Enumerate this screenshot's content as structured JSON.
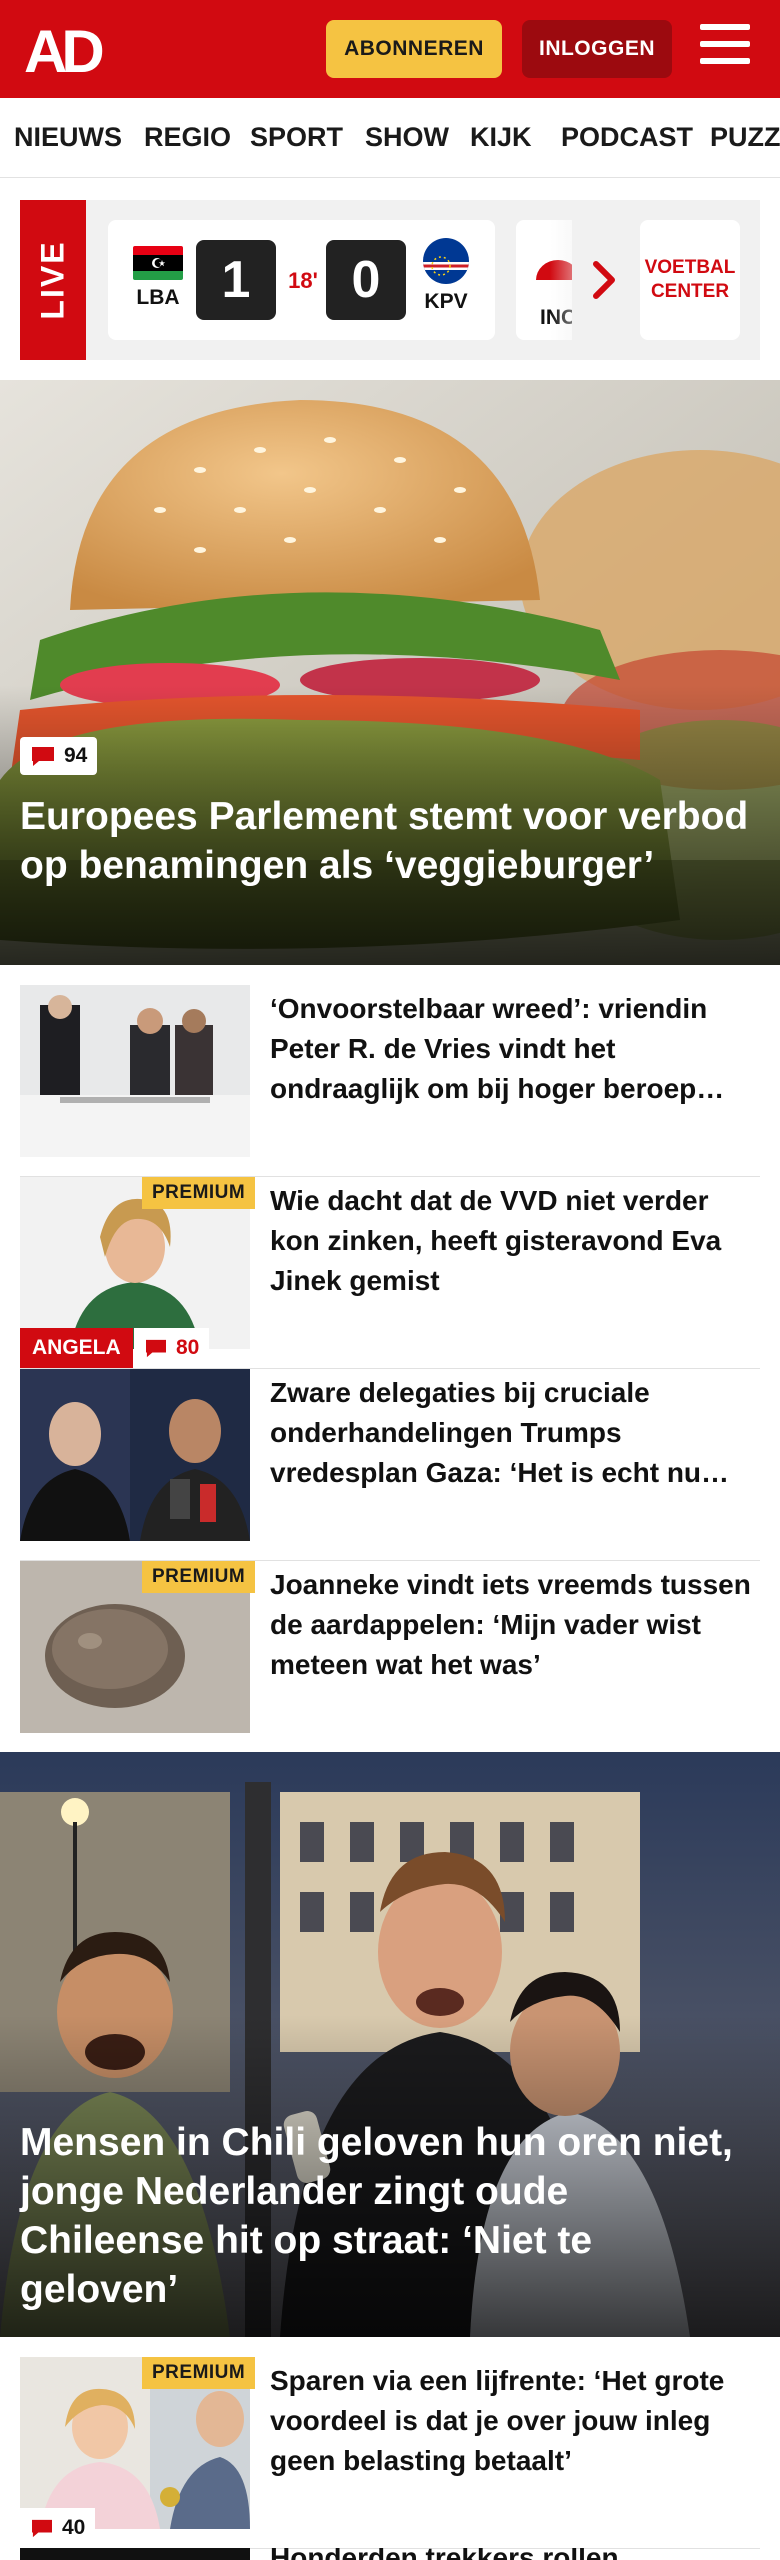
{
  "header": {
    "logo_text": "AD",
    "subscribe_label": "ABONNEREN",
    "login_label": "INLOGGEN",
    "menu_icon": "hamburger-menu-icon",
    "brand_color": "#d10a11",
    "accent_color": "#f5c342"
  },
  "nav": {
    "items": [
      "NIEUWS",
      "REGIO",
      "SPORT",
      "SHOW",
      "KIJK",
      "PODCAST",
      "PUZZ"
    ]
  },
  "live": {
    "label": "LIVE",
    "match": {
      "home_code": "LBA",
      "home_score": "1",
      "minute": "18'",
      "away_score": "0",
      "away_code": "KPV"
    },
    "next_match_code": "INC",
    "chevron_icon": "chevron-right-icon",
    "voetbal_center_label": "VOETBAL CENTER"
  },
  "hero": {
    "comment_count": "94",
    "title": "Europees Parlement stemt voor verbod op benamingen als ‘veggieburger’"
  },
  "articles": [
    {
      "title": "‘Onvoorstelbaar wreed’: vriendin Peter R. de Vries vindt het ondraaglijk om bij hoger beroep…",
      "premium": false
    },
    {
      "title": "Wie dacht dat de VVD niet verder kon zinken, heeft gisteravond Eva Jinek gemist",
      "premium": true,
      "premium_label": "PREMIUM",
      "author_tag": "ANGELA",
      "comment_count": "80"
    },
    {
      "title": "Zware delegaties bij cruciale onderhandelingen Trumps vredesplan Gaza: ‘Het is echt nu…",
      "premium": false
    },
    {
      "title": "Joanneke vindt iets vreemds tussen de aardappelen: ‘Mijn vader wist meteen wat het was’",
      "premium": true,
      "premium_label": "PREMIUM"
    }
  ],
  "hero2": {
    "title": "Mensen in Chili geloven hun oren niet, jonge Nederlander zingt oude Chileense hit op straat: ‘Niet te geloven’"
  },
  "article_after": {
    "title": "Sparen via een lijfrente: ‘Het grote voordeel is dat je over jouw inleg geen belasting betaalt’",
    "premium_label": "PREMIUM",
    "comment_count": "40"
  },
  "truncated_next": {
    "title": "Honderden trekkers rollen"
  }
}
